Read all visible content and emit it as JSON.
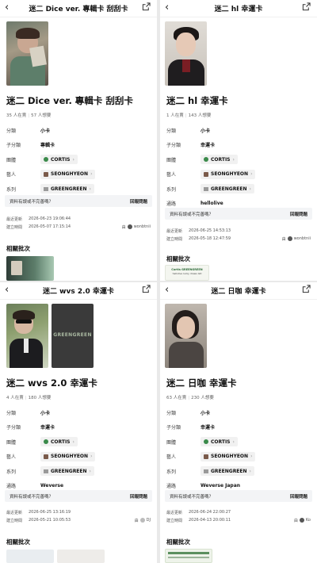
{
  "labels": {
    "category": "分類",
    "subcategory": "子分類",
    "group": "團體",
    "artist": "藝人",
    "series": "系列",
    "channel": "通路",
    "people_have": "人在賣",
    "people_want": "人想要",
    "report_question": "資料有誤或不完善嗎？",
    "report_button": "回報問題",
    "last_updated": "最近更新",
    "created_time": "建立時間",
    "by": "由",
    "related": "相關批次"
  },
  "panels": [
    {
      "header": "迷二 Dice ver. 專輯卡 刮刮卡",
      "title": "迷二 Dice ver. 專輯卡 刮刮卡",
      "have": "35",
      "want": "57",
      "category": "小卡",
      "subcategory": "專輯卡",
      "group": "CORTIS",
      "artist": "SEONGHYEON",
      "series": "GREENGREEN",
      "updated": "2026-06-23 19:06:44",
      "created": "2026-05-07 17:15:14",
      "author": "wonbtnii"
    },
    {
      "header": "迷二 hl 幸運卡",
      "title": "迷二 hl 幸運卡",
      "have": "1",
      "want": "143",
      "category": "小卡",
      "subcategory": "幸運卡",
      "group": "CORTIS",
      "artist": "SEONGHYEON",
      "series": "GREENGREEN",
      "channel": "hellolive",
      "updated": "2026-06-25 14:53:13",
      "created": "2026-05-18 12:47:59",
      "author": "wonbtnii",
      "related_thumb_text": [
        "Cortis GREENGREEN",
        "hellolive lucky draws GD"
      ]
    },
    {
      "header": "迷二 wvs 2.0 幸運卡",
      "title": "迷二 wvs 2.0 幸運卡",
      "have": "4",
      "want": "180",
      "category": "小卡",
      "subcategory": "幸運卡",
      "group": "CORTIS",
      "artist": "SEONGHYEON",
      "series": "GREENGREEN",
      "channel": "Weverse",
      "updated": "2026-06-25 13:16:19",
      "created": "2026-05-21 10:05:53",
      "author": "DJ",
      "photo2_text": "GREENGREEN"
    },
    {
      "header": "迷二 日咖 幸運卡",
      "title": "迷二 日咖 幸運卡",
      "have": "63",
      "want": "230",
      "category": "小卡",
      "subcategory": "幸運卡",
      "group": "CORTIS",
      "artist": "SEONGHYEON",
      "series": "GREENGREEN",
      "channel": "Weverse Japan",
      "updated": "2026-06-24 22:00:27",
      "created": "2026-04-13 20:00:11",
      "author": "Ko"
    }
  ]
}
